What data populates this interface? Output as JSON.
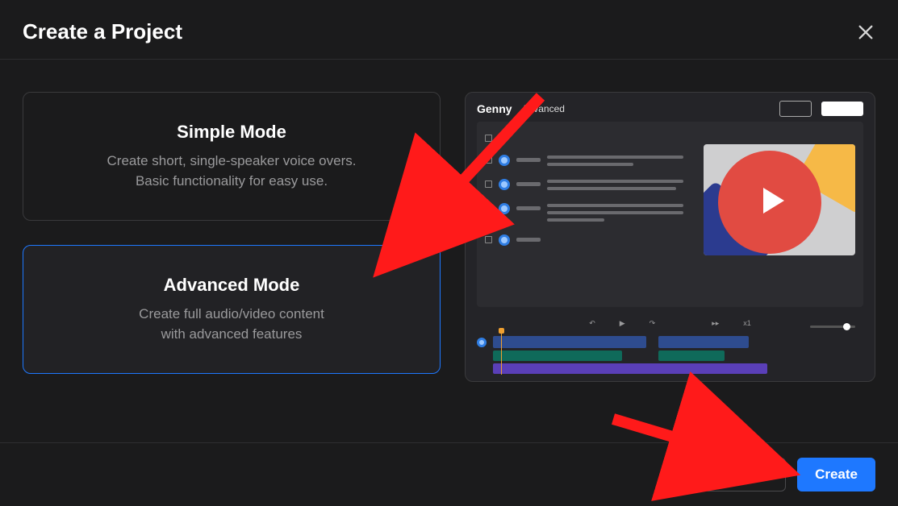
{
  "header": {
    "title": "Create a Project"
  },
  "modes": {
    "simple": {
      "title": "Simple Mode",
      "desc1": "Create short, single-speaker voice overs.",
      "desc2": "Basic functionality for easy use."
    },
    "advanced": {
      "title": "Advanced Mode",
      "desc1": "Create full audio/video content",
      "desc2": "with advanced features"
    }
  },
  "preview": {
    "logo": "Genny",
    "mode_label": "Advanced",
    "speed": "x1"
  },
  "footer": {
    "cancel": "Cancel",
    "create": "Create"
  }
}
